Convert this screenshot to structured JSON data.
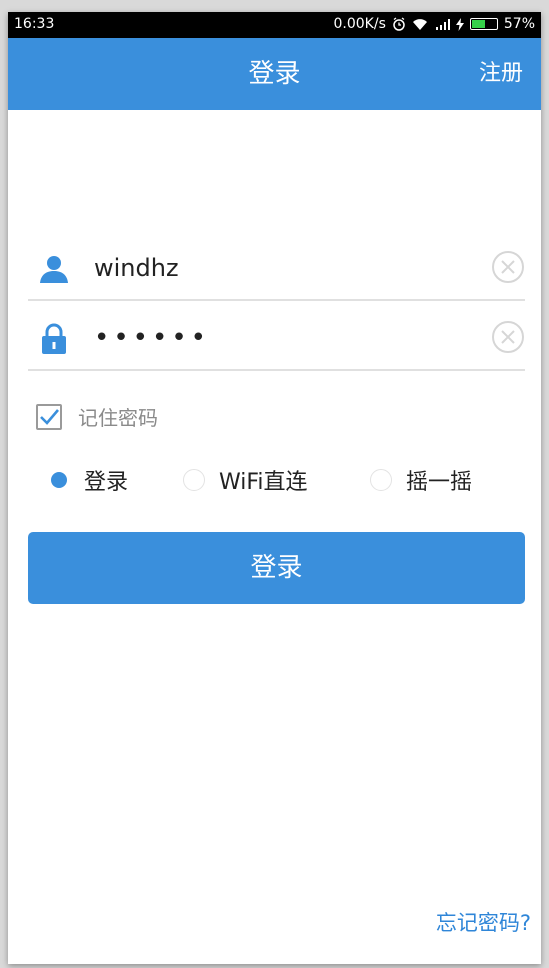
{
  "status_bar": {
    "time": "16:33",
    "net_speed": "0.00K/s",
    "battery": "57%",
    "battery_level": 0.57,
    "icons": [
      "alarm-icon",
      "wifi-icon",
      "signal-icon",
      "charging-icon",
      "battery-icon"
    ]
  },
  "app_bar": {
    "title": "登录",
    "register_label": "注册",
    "background_color": "#3a8fdc"
  },
  "form": {
    "username": {
      "icon": "user-icon",
      "value": "windhz",
      "clear_icon": "clear-icon"
    },
    "password": {
      "icon": "lock-icon",
      "value": "••••••",
      "clear_icon": "clear-icon"
    },
    "remember": {
      "label": "记住密码",
      "checked": true
    },
    "modes": [
      {
        "label": "登录",
        "selected": true
      },
      {
        "label": "WiFi直连",
        "selected": false
      },
      {
        "label": "摇一摇",
        "selected": false
      }
    ],
    "submit_label": "登录"
  },
  "footer": {
    "forgot_label": "忘记密码?"
  },
  "colors": {
    "accent": "#3a8fdc",
    "link": "#2f86d8",
    "divider": "#e0e0e0"
  }
}
